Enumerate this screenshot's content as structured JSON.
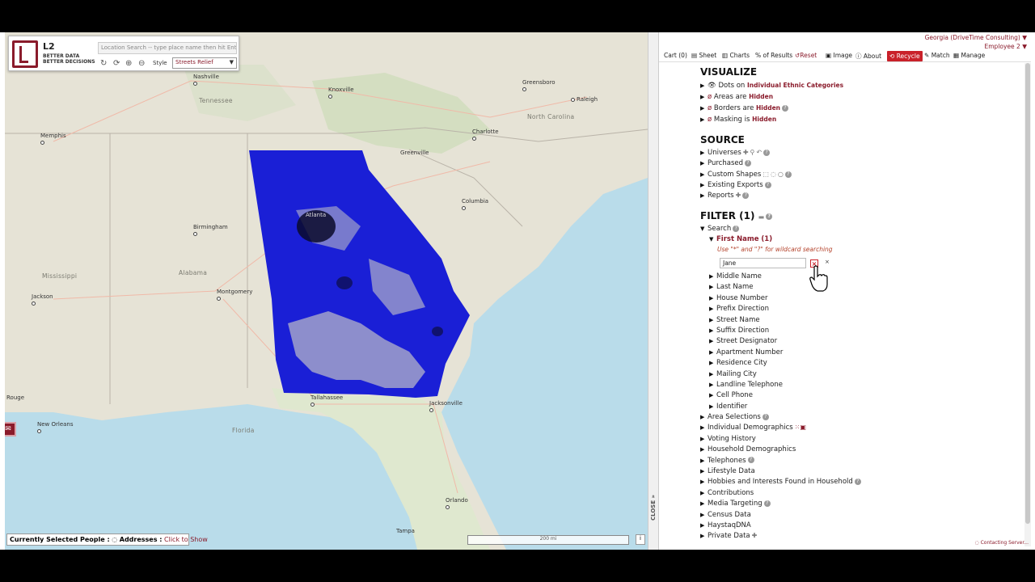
{
  "map": {
    "logo_title": "L2",
    "logo_tagline_1": "BETTER DATA",
    "logo_tagline_2": "BETTER DECISIONS",
    "search_placeholder": "Location Search -- type place name then hit Ente",
    "style_label": "Style",
    "style_value": "Streets Relief",
    "selected_people_label": "Currently Selected People :",
    "addresses_label": "Addresses :",
    "click_to_show": "Click to Show",
    "scale_label": "200 mi",
    "cities": [
      {
        "name": "Nashville"
      },
      {
        "name": "Knoxville"
      },
      {
        "name": "Greensboro"
      },
      {
        "name": "Raleigh"
      },
      {
        "name": "Memphis"
      },
      {
        "name": "Charlotte"
      },
      {
        "name": "Greenville"
      },
      {
        "name": "Atlanta"
      },
      {
        "name": "Birmingham"
      },
      {
        "name": "Columbia"
      },
      {
        "name": "Montgomery"
      },
      {
        "name": "Jackson"
      },
      {
        "name": "Tallahassee"
      },
      {
        "name": "Jacksonville"
      },
      {
        "name": "Rouge"
      },
      {
        "name": "New Orleans"
      },
      {
        "name": "Orlando"
      },
      {
        "name": "Tampa"
      }
    ],
    "states": [
      {
        "name": "Tennessee"
      },
      {
        "name": "North Carolina"
      },
      {
        "name": "Mississippi"
      },
      {
        "name": "Alabama"
      },
      {
        "name": "Florida"
      }
    ]
  },
  "divider": {
    "close_label": "CLOSE"
  },
  "account": {
    "name": "Georgia (DriveTime Consulting)",
    "user": "Employee 2"
  },
  "toolbar": {
    "cart": "Cart (0)",
    "sheet": "Sheet",
    "charts": "Charts",
    "pct": "% of Results",
    "reset": "Reset",
    "image": "Image",
    "about": "About",
    "recycle": "Recycle",
    "match": "Match",
    "manage": "Manage"
  },
  "visualize": {
    "title": "VISUALIZE",
    "dots_label": "Dots",
    "dots_on": "on",
    "dots_value": "Individual Ethnic Categories",
    "areas_label": "Areas",
    "areas_are": "are",
    "areas_value": "Hidden",
    "borders_label": "Borders",
    "borders_are": "are",
    "borders_value": "Hidden",
    "masking_label": "Masking",
    "masking_is": "is",
    "masking_value": "Hidden"
  },
  "source": {
    "title": "SOURCE",
    "items": [
      "Universes",
      "Purchased",
      "Custom Shapes",
      "Existing Exports",
      "Reports"
    ]
  },
  "filter": {
    "title": "FILTER (1)",
    "search": "Search",
    "first_name": "First Name (1)",
    "hint": "Use \"*\" and \"?\" for wildcard searching",
    "first_name_value": "Jane",
    "search_fields": [
      "Middle Name",
      "Last Name",
      "House Number",
      "Prefix Direction",
      "Street Name",
      "Suffix Direction",
      "Street Designator",
      "Apartment Number",
      "Residence City",
      "Mailing City",
      "Landline Telephone",
      "Cell Phone",
      "Identifier"
    ],
    "groups": [
      "Area Selections",
      "Individual Demographics",
      "Voting History",
      "Household Demographics",
      "Telephones",
      "Lifestyle Data",
      "Hobbies and Interests Found in Household",
      "Contributions",
      "Media Targeting",
      "Census Data",
      "HaystaqDNA",
      "Private Data"
    ]
  },
  "status": "Contacting Server..."
}
